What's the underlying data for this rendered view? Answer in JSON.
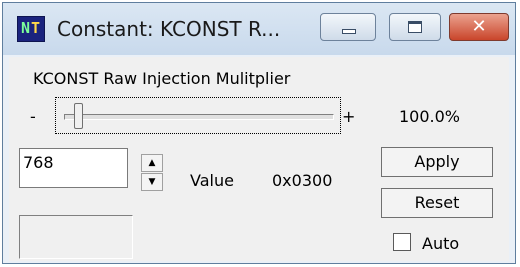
{
  "window": {
    "title": "Constant: KCONST R...",
    "icon": "nt-app-icon",
    "controls": {
      "minimize": "minimize-icon",
      "maximize": "maximize-icon",
      "close": "close-icon"
    }
  },
  "app_icon": {
    "left_letter": "N",
    "right_letter": "T"
  },
  "parameter": {
    "name": "KCONST Raw Injection Mulitplier",
    "slider": {
      "min_label": "-",
      "max_label": "+",
      "percent_text": "100.0%",
      "level_fraction": 0.03
    },
    "value_input": "768",
    "spin_up": "▲",
    "spin_down": "▼",
    "value_label": "Value",
    "value_hex": "0x0300"
  },
  "buttons": {
    "apply": "Apply",
    "reset": "Reset"
  },
  "auto": {
    "label": "Auto",
    "checked": false
  }
}
